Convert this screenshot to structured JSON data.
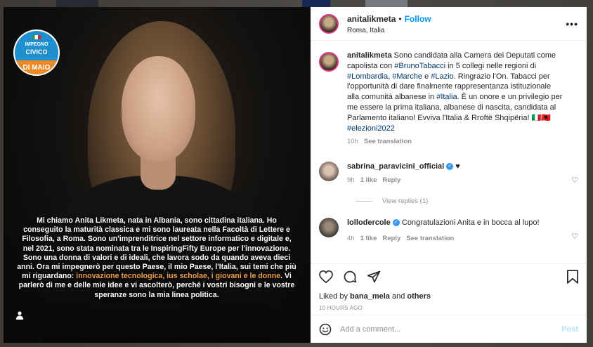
{
  "post": {
    "author": "anitalikmeta",
    "separator": "•",
    "follow_label": "Follow",
    "location": "Roma, Italia",
    "more_label": "•••"
  },
  "image": {
    "logo": {
      "line1": "IMPEGNO",
      "line2": "CIVICO",
      "line3": "DI MAIO"
    },
    "caption_parts": [
      "Mi chiamo Anita Likmeta, nata in Albania, sono cittadina italiana. Ho conseguito la maturità classica e mi sono laureata nella Facoltà di Lettere e Filosofia, a Roma. Sono un'imprenditrice nel settore informatico e digitale e, nel 2021, sono stata nominata tra le InspiringFifty Europe per l'innovazione. Sono una donna di valori e di ideali, che lavora sodo da quando aveva dieci anni. Ora mi impegnerò per questo Paese, il mio Paese, l'Italia, sui temi che più mi riguardano: ",
      "innovazione tecnologica",
      ", ",
      "ius scholae",
      ", ",
      "i giovani e le donne",
      ". Vi parlerò di me e delle mie idee e vi ascolterò, perché i vostri bisogni e le vostre speranze sono la mia linea politica."
    ]
  },
  "caption": {
    "username": "anitalikmeta",
    "t1": " Sono candidata alla Camera dei Deputati come capolista con ",
    "tag1": "#BrunoTabacci",
    "t2": " in 5 collegi nelle regioni di ",
    "tag2": "#Lombardia",
    "t3": ", ",
    "tag3": "#Marche",
    "t4": " e ",
    "tag4": "#Lazio",
    "t5": ". Ringrazio l'On. Tabacci per l'opportunità di dare finalmente rappresentanza istituzionale alla comunità albanese in ",
    "tag5": "#Italia",
    "t6": ". È un onore e un privilegio per me essere la prima italiana, albanese di nascita, candidata al Parlamento italiano! Evviva l'Italia & Rroftë Shqipëria! 🇮🇹🇦🇱 ",
    "tag6": "#elezioni2022",
    "time": "10h",
    "see_translation": "See translation"
  },
  "comments": [
    {
      "username": "sabrina_paravicini_official",
      "text": " ♥",
      "time": "9h",
      "likes": "1 like",
      "reply": "Reply",
      "view_replies": "View replies (1)"
    },
    {
      "username": "lollodercole",
      "text": " Congratulazioni Anita e in bocca al lupo!",
      "time": "4h",
      "likes": "1 like",
      "reply": "Reply",
      "see_translation": "See translation"
    }
  ],
  "stats": {
    "liked_prefix": "Liked by ",
    "liked_user": "bana_mela",
    "liked_and": " and ",
    "liked_others": "others",
    "timestamp": "10 HOURS AGO"
  },
  "composer": {
    "placeholder": "Add a comment...",
    "post_label": "Post"
  },
  "colors": {
    "accent": "#0095f6",
    "hashtag": "#00376b",
    "highlight": "#f0a048"
  }
}
